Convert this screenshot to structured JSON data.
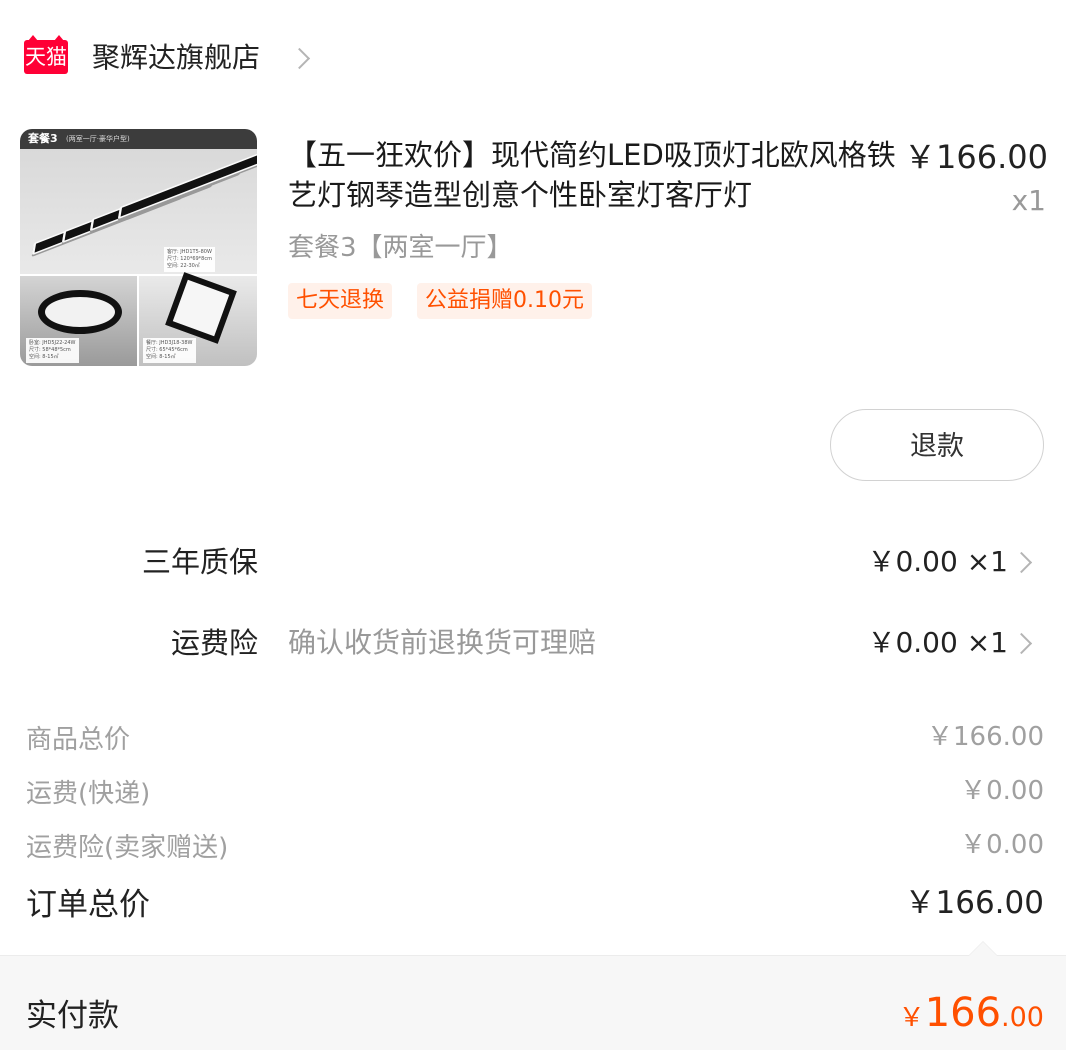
{
  "store": {
    "logo_text": "天猫",
    "name": "聚辉达旗舰店"
  },
  "product": {
    "image": {
      "package_tag": "套餐3",
      "package_sub": "(两室一厅·豪华户型)",
      "spec_top": [
        "客厅: JHD1T5-80W",
        "尺寸: 120*69*8cm",
        "空间: 22-30㎡"
      ],
      "spec_left": [
        "卧室: JHD5J22-24W",
        "尺寸: 58*48*5cm",
        "空间: 8-15㎡"
      ],
      "spec_right": [
        "餐厅: JHD3J18-38W",
        "尺寸: 65*45*6cm",
        "空间: 8-15㎡"
      ]
    },
    "title": "【五一狂欢价】现代简约LED吸顶灯北欧风格铁艺灯钢琴造型创意个性卧室灯客厅灯",
    "price": "￥166.00",
    "quantity": "x1",
    "sku": "套餐3【两室一厅】",
    "tags": [
      "七天退换",
      "公益捐赠0.10元"
    ]
  },
  "actions": {
    "refund_label": "退款"
  },
  "services": [
    {
      "label": "三年质保",
      "note": "",
      "value": "￥0.00 ×1"
    },
    {
      "label": "运费险",
      "note": "确认收货前退换货可理赔",
      "value": "￥0.00 ×1"
    }
  ],
  "summary": {
    "items": [
      {
        "label": "商品总价",
        "value": "￥166.00"
      },
      {
        "label": "运费(快递)",
        "value": "￥0.00"
      },
      {
        "label": "运费险(卖家赠送)",
        "value": "￥0.00"
      }
    ],
    "total_label": "订单总价",
    "total_value": "￥166.00",
    "paid_label": "实付款",
    "paid_symbol": "￥",
    "paid_int": "166",
    "paid_dec": ".00"
  },
  "colors": {
    "brand": "#ff0036",
    "accent": "#ff5000",
    "muted": "#999999"
  }
}
